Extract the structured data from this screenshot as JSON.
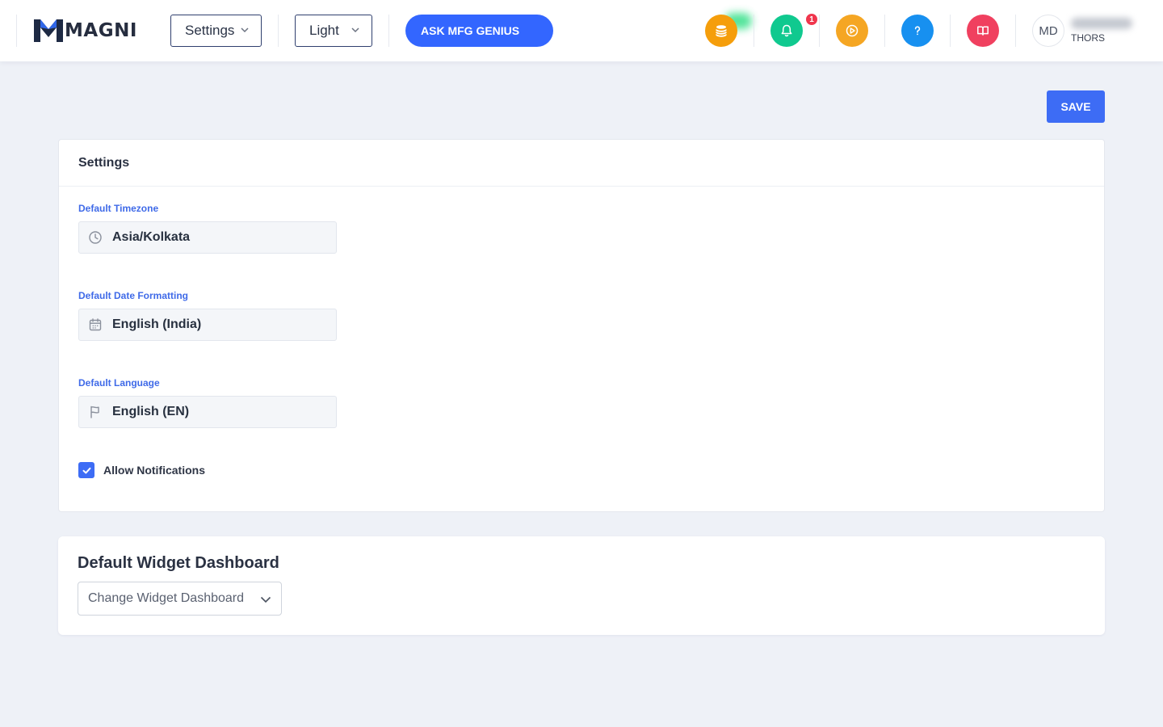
{
  "header": {
    "brand": "MAGNI",
    "module_dropdown": "Settings",
    "theme_dropdown": "Light",
    "ask_button": "ASK MFG GENIUS",
    "notification_count": "1",
    "icons": [
      "coins-icon",
      "bell-icon",
      "play-circle-icon",
      "help-icon",
      "book-icon"
    ],
    "colors": {
      "coins": "#f59e0b",
      "bell": "#10c98f",
      "play": "#f5a623",
      "help": "#1790f0",
      "book": "#f0405f",
      "accent": "#3366ff"
    },
    "user": {
      "initials": "MD",
      "org": "THORS"
    }
  },
  "actions": {
    "save": "SAVE"
  },
  "settings_card": {
    "title": "Settings",
    "timezone": {
      "label": "Default Timezone",
      "value": "Asia/Kolkata",
      "icon": "clock-icon"
    },
    "date_format": {
      "label": "Default Date Formatting",
      "value": "English (India)",
      "icon": "calendar-icon"
    },
    "language": {
      "label": "Default Language",
      "value": "English (EN)",
      "icon": "flag-icon"
    },
    "notifications": {
      "label": "Allow Notifications",
      "checked": true
    }
  },
  "widget_card": {
    "title": "Default Widget Dashboard",
    "select_placeholder": "Change Widget Dashboard"
  }
}
